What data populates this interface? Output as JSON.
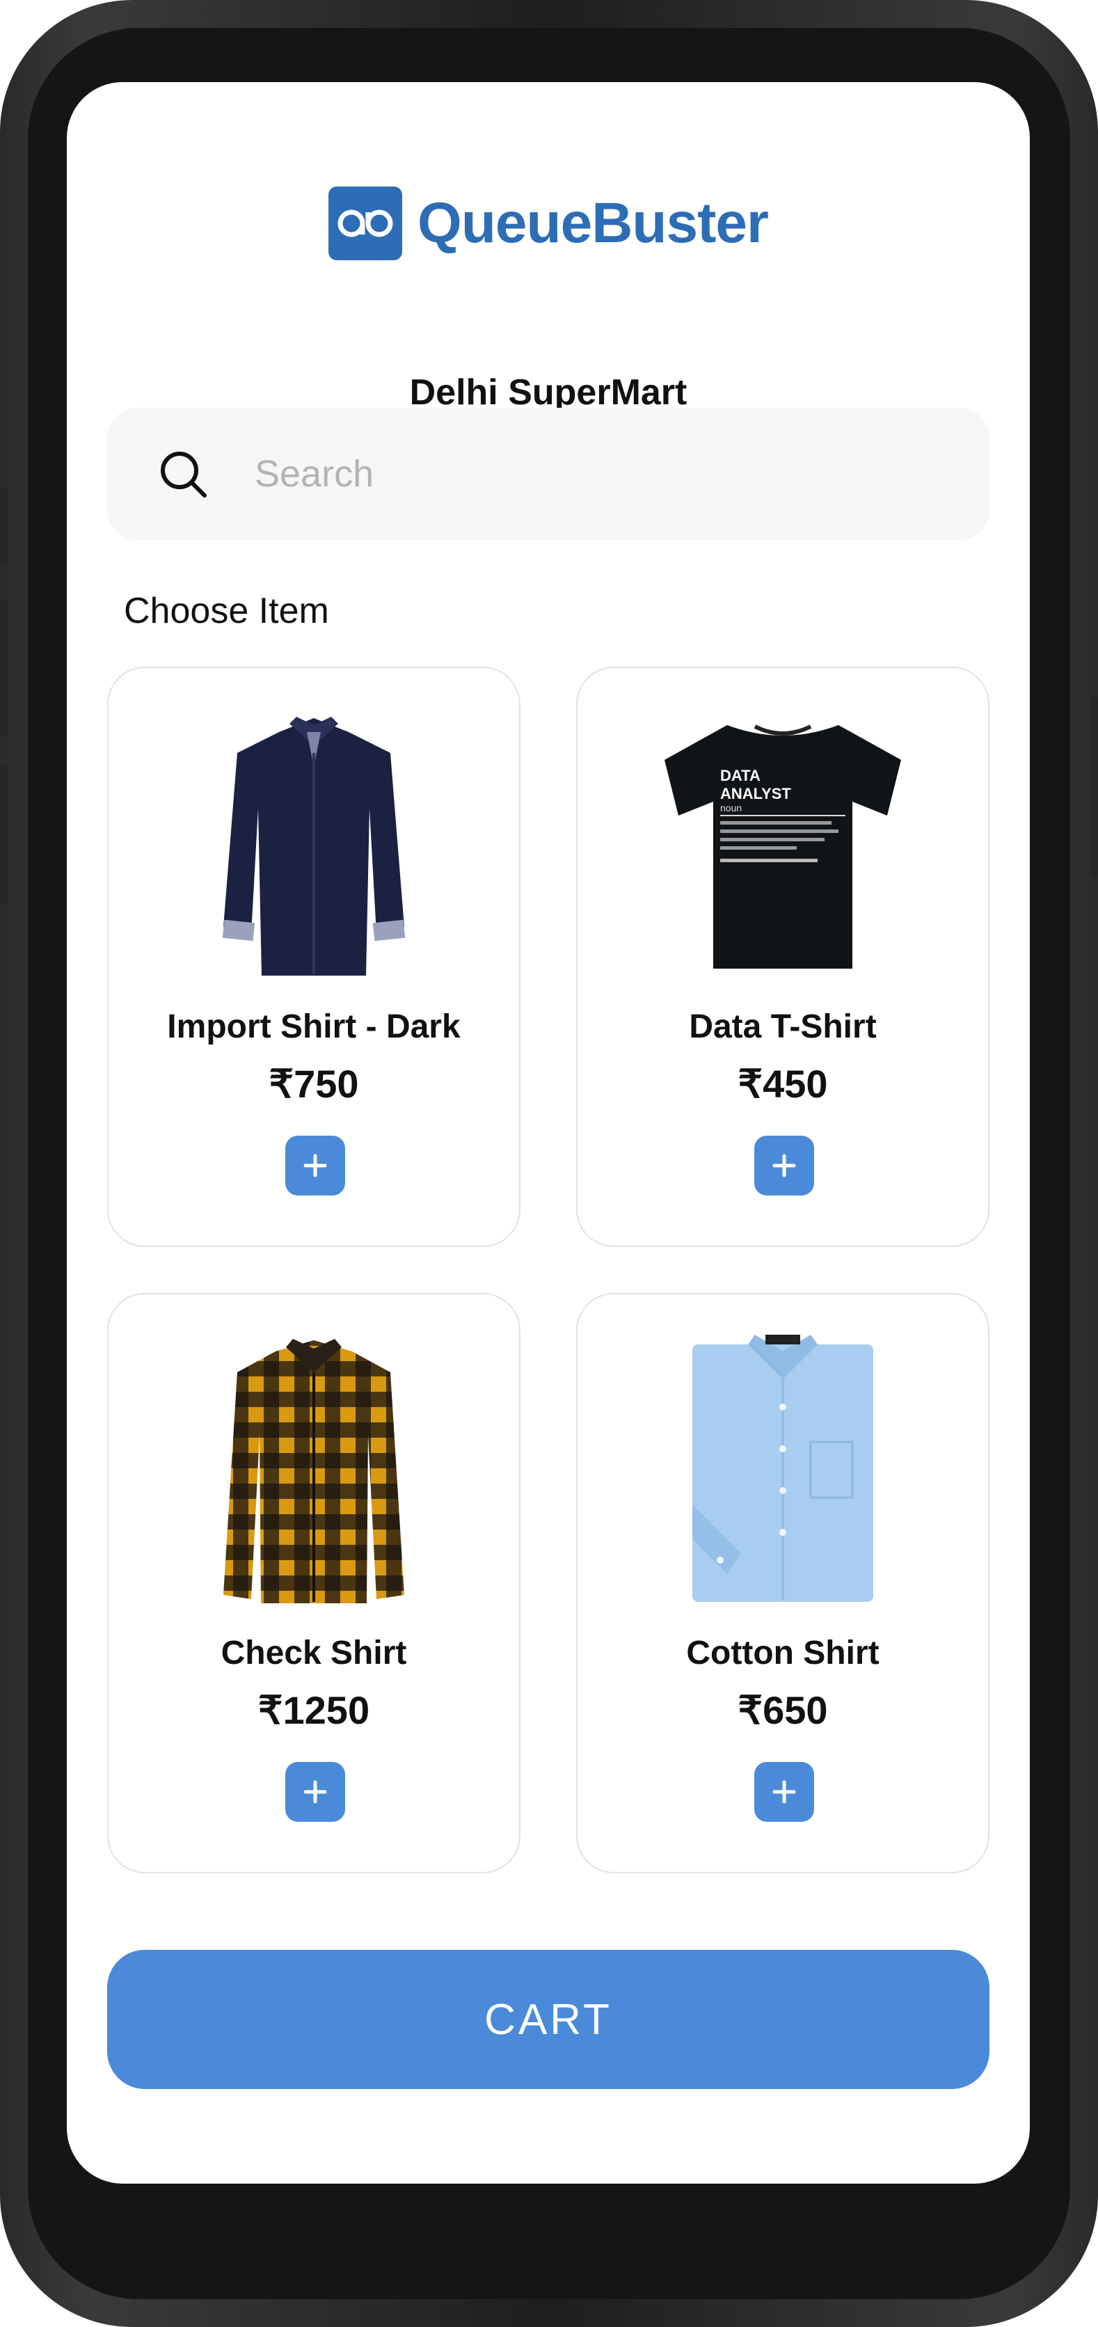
{
  "app": {
    "logo_text": "QueueBuster",
    "logo_mark_text": "qb",
    "store_name": "Delhi SuperMart",
    "brand_color": "#2d6db5",
    "accent_color": "#4a8ad9"
  },
  "search": {
    "placeholder": "Search",
    "value": "",
    "icon": "search-icon"
  },
  "section": {
    "title": "Choose Item"
  },
  "products": [
    {
      "name": "Import Shirt - Dark",
      "price": "₹750",
      "add_label": "+",
      "image": "navy-dress-shirt"
    },
    {
      "name": "Data T-Shirt",
      "price": "₹450",
      "add_label": "+",
      "image": "black-tshirt-data-analyst"
    },
    {
      "name": "Check Shirt",
      "price": "₹1250",
      "add_label": "+",
      "image": "yellow-black-check-shirt"
    },
    {
      "name": "Cotton Shirt",
      "price": "₹650",
      "add_label": "+",
      "image": "light-blue-cotton-shirt"
    }
  ],
  "tshirt_print": {
    "line1": "DATA",
    "line2": "ANALYST",
    "line3": "noun"
  },
  "cart": {
    "label": "CART"
  }
}
